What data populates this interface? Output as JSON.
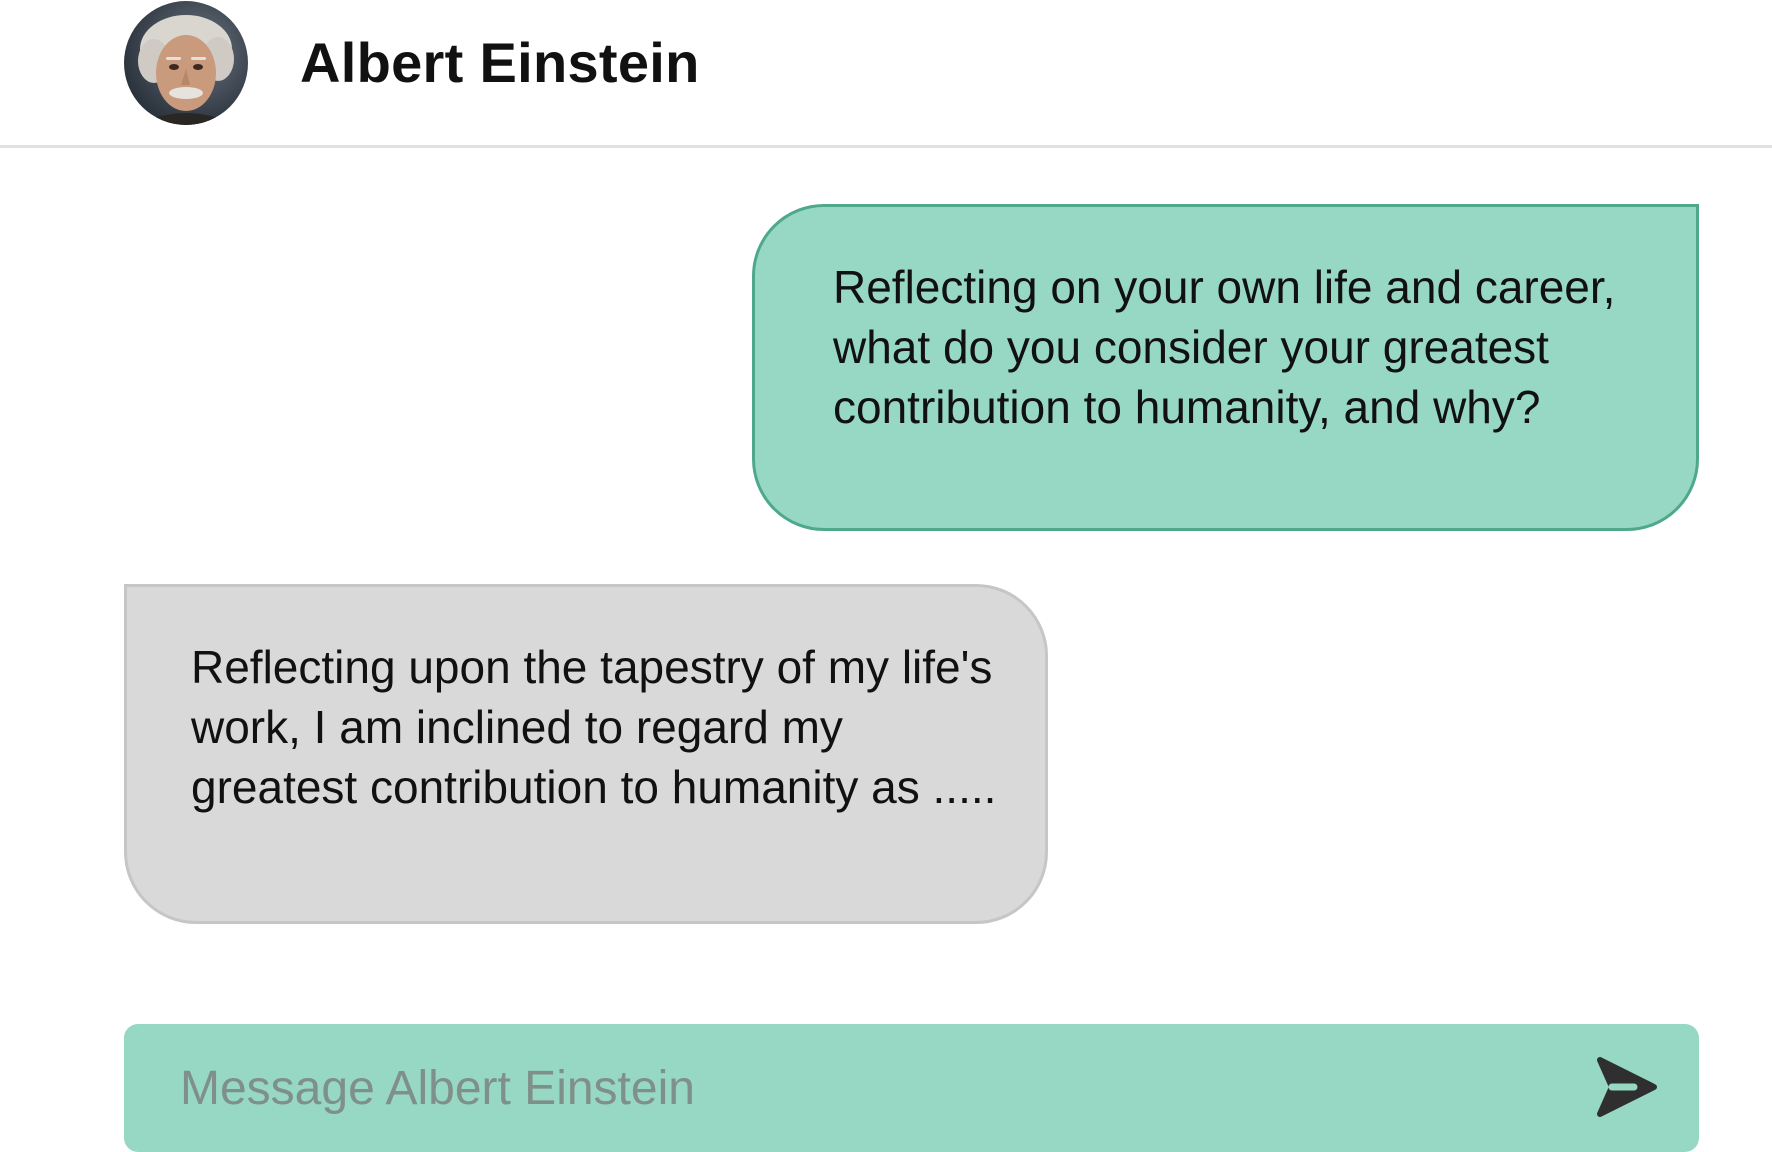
{
  "header": {
    "contact_name": "Albert Einstein",
    "avatar_icon": "einstein-portrait-avatar"
  },
  "messages": [
    {
      "direction": "outgoing",
      "text": "Reflecting on your own life and career, what do you consider your greatest contribution to humanity, and why?"
    },
    {
      "direction": "incoming",
      "text": "Reflecting upon the tapestry of my life's work, I am inclined to regard my greatest contribution to humanity as ....."
    }
  ],
  "composer": {
    "value": "",
    "placeholder": "Message Albert Einstein",
    "send_icon": "send-arrow-icon"
  },
  "colors": {
    "accent": "#97d8c4",
    "accent_border": "#4fa88b",
    "incoming_bubble": "#d9d9d9",
    "send_icon": "#2f2f2f"
  }
}
